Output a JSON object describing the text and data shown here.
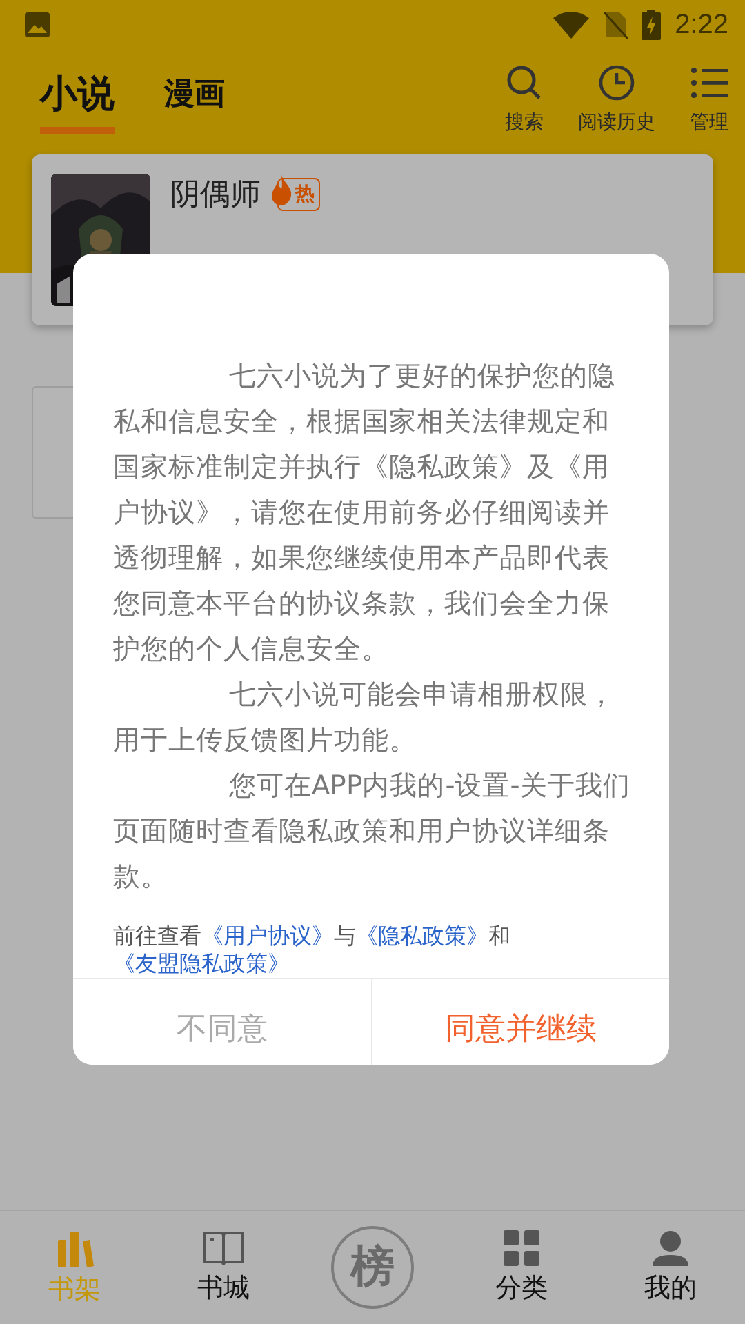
{
  "status_bar": {
    "time": "2:22"
  },
  "top_tabs": [
    {
      "label": "小说",
      "selected": true
    },
    {
      "label": "漫画",
      "selected": false
    }
  ],
  "header_actions": [
    {
      "kind": "search",
      "label": "搜索"
    },
    {
      "kind": "history",
      "label": "阅读历史"
    },
    {
      "kind": "manage",
      "label": "管理"
    }
  ],
  "book": {
    "title": "阴偶师",
    "badge": "热"
  },
  "dialog": {
    "paragraphs": [
      "七六小说为了更好的保护您的隐私和信息安全，根据国家相关法律规定和国家标准制定并执行《隐私政策》及《用户协议》，请您在使用前务必仔细阅读并透彻理解，如果您继续使用本产品即代表您同意本平台的协议条款，我们会全力保护您的个人信息安全。",
      "七六小说可能会申请相册权限，用于上传反馈图片功能。",
      "您可在APP内我的-设置-关于我们页面随时查看隐私政策和用户协议详细条款。"
    ],
    "links_line": [
      {
        "kind": "text",
        "text": "前往查看"
      },
      {
        "kind": "link",
        "text": "《用户协议》"
      },
      {
        "kind": "text",
        "text": "与"
      },
      {
        "kind": "link",
        "text": "《隐私政策》"
      },
      {
        "kind": "text",
        "text": "和"
      },
      {
        "kind": "link",
        "text": "《友盟隐私政策》"
      }
    ],
    "buttons": [
      {
        "kind": "decline",
        "label": "不同意"
      },
      {
        "kind": "accept",
        "label": "同意并继续"
      }
    ]
  },
  "bottom_nav": [
    {
      "kind": "shelf",
      "label": "书架",
      "selected": true
    },
    {
      "kind": "store",
      "label": "书城",
      "selected": false
    },
    {
      "kind": "rank",
      "label": "榜",
      "selected": false
    },
    {
      "kind": "category",
      "label": "分类",
      "selected": false
    },
    {
      "kind": "mine",
      "label": "我的",
      "selected": false
    }
  ]
}
